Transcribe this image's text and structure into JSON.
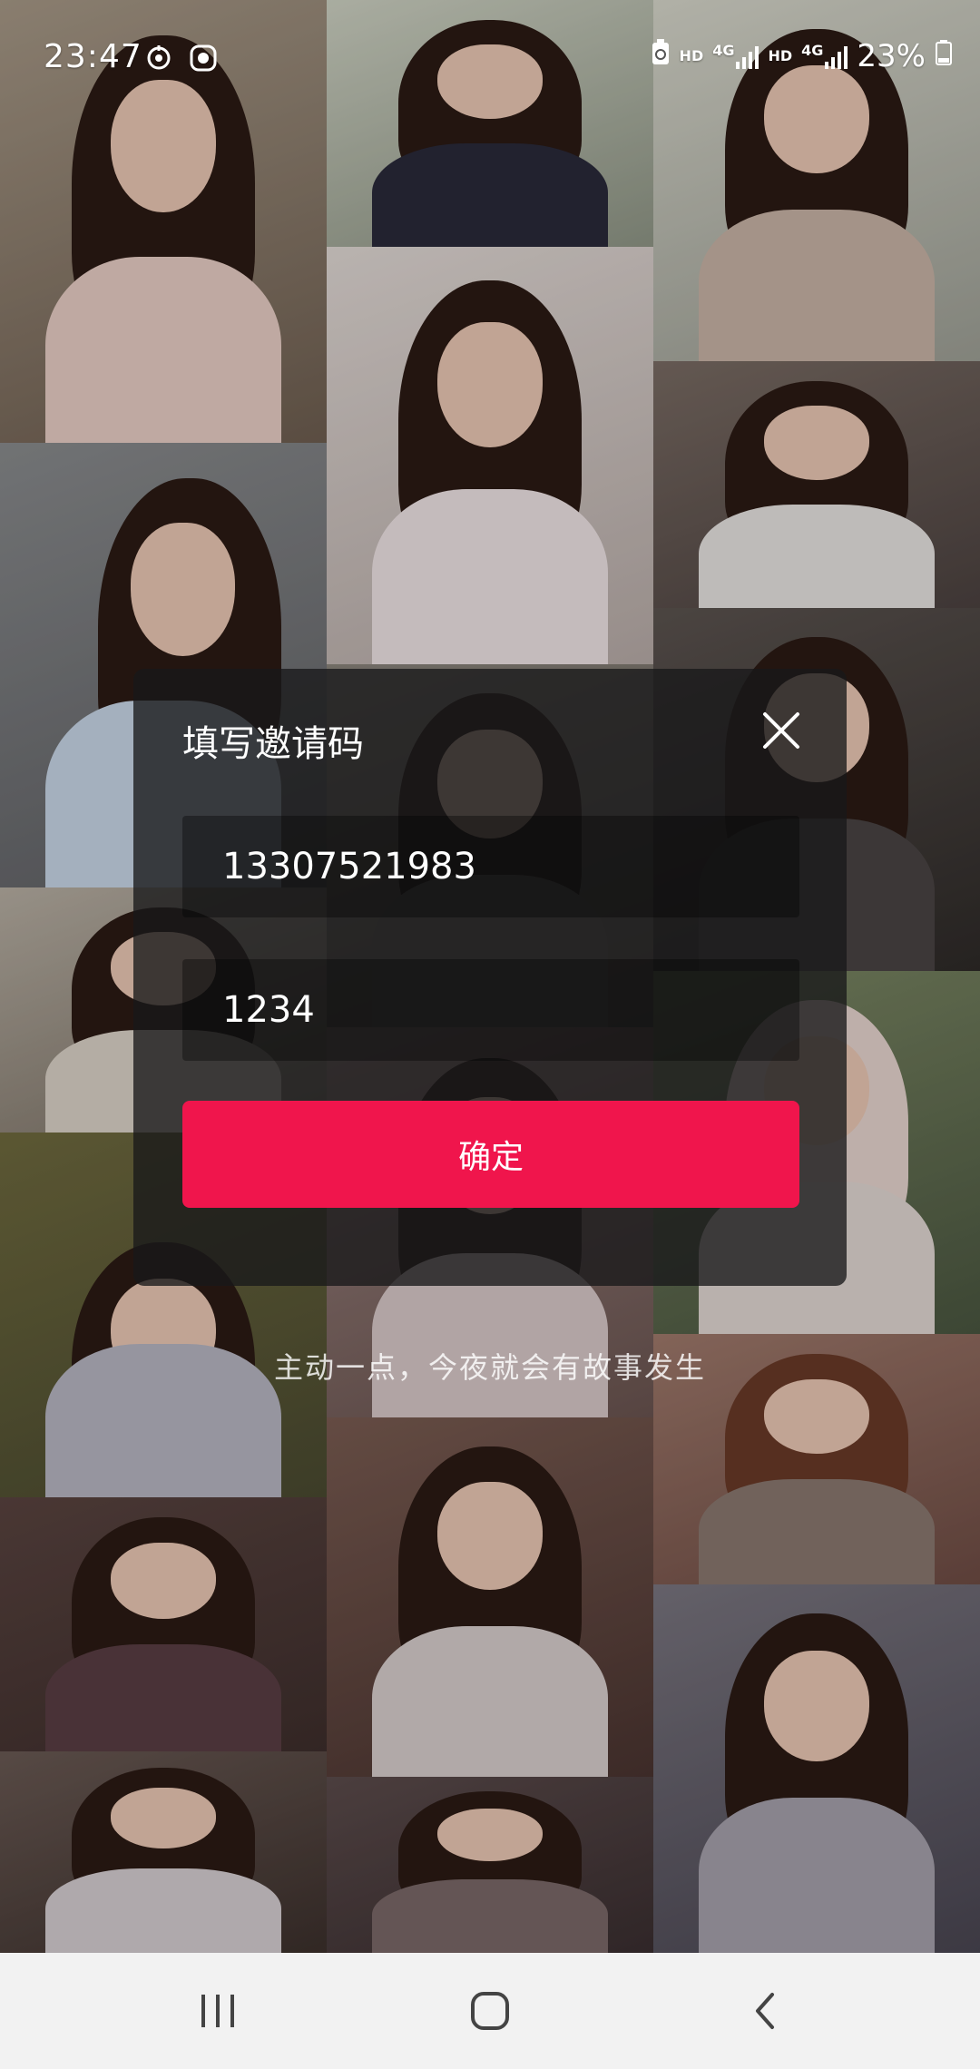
{
  "status_bar": {
    "time": "23:47",
    "hd_label_1": "HD",
    "network_label_1": "4G",
    "hd_label_2": "HD",
    "network_label_2": "4G",
    "battery_percent": "23%"
  },
  "dialog": {
    "title": "填写邀请码",
    "phone_value": "13307521983",
    "code_value": "1234",
    "confirm_label": "确定"
  },
  "tagline": "主动一点，今夜就会有故事发生",
  "colors": {
    "accent": "#f0154c",
    "nav_bar": "#f2f2f2"
  },
  "icons": {
    "close": "close-icon",
    "recent_apps": "recent-apps-icon",
    "home": "home-icon",
    "back": "back-icon"
  }
}
